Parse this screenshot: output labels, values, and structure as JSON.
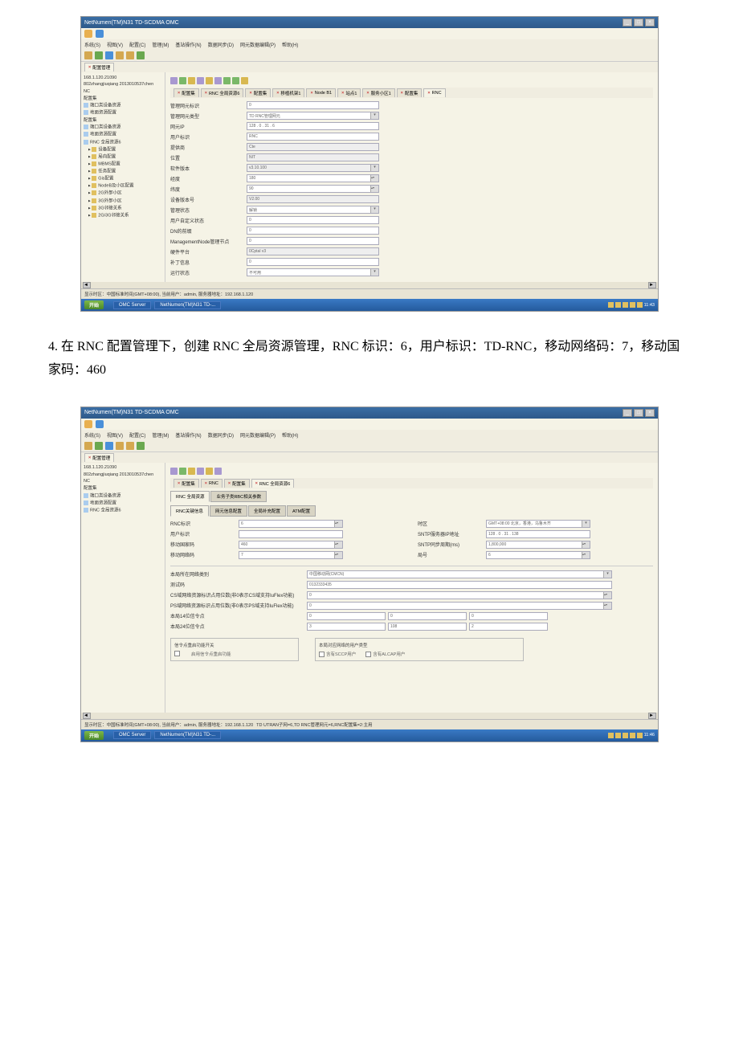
{
  "s1": {
    "title": "NetNumen(TM)N31 TD-SCDMA OMC",
    "menu": [
      "系统(S)",
      "视图(V)",
      "配置(C)",
      "管理(M)",
      "基站操作(N)",
      "数据同步(D)",
      "网元数据编辑(P)",
      "帮助(H)"
    ],
    "toolbar_tab": "配置管理",
    "tree": [
      {
        "t": "168.1.120.21090",
        "l": 0
      },
      {
        "t": "802zhangjiuqiang 2013010537chen",
        "l": 0
      },
      {
        "t": "NC",
        "l": 0
      },
      {
        "t": "配置集",
        "l": 0
      },
      {
        "t": "端口类设备资源",
        "l": 0,
        "ic": "doc"
      },
      {
        "t": "地面资源配置",
        "l": 0,
        "ic": "doc"
      },
      {
        "t": "配置集",
        "l": 0
      },
      {
        "t": "端口类设备资源",
        "l": 0,
        "ic": "doc"
      },
      {
        "t": "地面资源配置",
        "l": 0,
        "ic": "doc"
      },
      {
        "t": "RNC 全局资源6",
        "l": 0,
        "ic": "doc"
      },
      {
        "t": "设备配置",
        "l": 1,
        "ic": "folder"
      },
      {
        "t": "局向配置",
        "l": 1,
        "ic": "folder"
      },
      {
        "t": "MBMS配置",
        "l": 1,
        "ic": "folder"
      },
      {
        "t": "任务配置",
        "l": 1,
        "ic": "folder"
      },
      {
        "t": "Gis配置",
        "l": 1,
        "ic": "folder"
      },
      {
        "t": "NodeB及小区配置",
        "l": 1,
        "ic": "folder"
      },
      {
        "t": "2G外部小区",
        "l": 1,
        "ic": "folder"
      },
      {
        "t": "3G外部小区",
        "l": 1,
        "ic": "folder"
      },
      {
        "t": "3G邻接关系",
        "l": 1,
        "ic": "folder"
      },
      {
        "t": "2G/3G邻接关系",
        "l": 1,
        "ic": "folder"
      }
    ],
    "tabs": [
      "配置集",
      "RNC 全局资源6",
      "配置集",
      "移植机架1",
      "Node B1",
      "站点1",
      "服务小区1",
      "配置集",
      "RNC"
    ],
    "form": [
      {
        "k": "管理网元标识",
        "v": "0"
      },
      {
        "k": "管理网元类型",
        "v": "TD RNC管理网元",
        "dd": true
      },
      {
        "k": "网元IP",
        "v": "128 . 0 . 31 . 6"
      },
      {
        "k": "用户标识",
        "v": "RNC"
      },
      {
        "k": "提供商",
        "v": "Cte",
        "ro": true
      },
      {
        "k": "位置",
        "v": "NIT",
        "ro": true
      },
      {
        "k": "软件版本",
        "v": "v3.10.100",
        "dd": true,
        "ro": true
      },
      {
        "k": "经度",
        "v": "180",
        "sp": true
      },
      {
        "k": "纬度",
        "v": "90",
        "sp": true
      },
      {
        "k": "设备版本号",
        "v": "V2.00",
        "ro": true
      },
      {
        "k": "管理状态",
        "v": "解锁",
        "dd": true
      },
      {
        "k": "用户自定义状态",
        "v": "0"
      },
      {
        "k": "DN的前缀",
        "v": "0"
      },
      {
        "k": "ManagementNode管理节点",
        "v": "0"
      },
      {
        "k": "硬件平台",
        "v": "0Cptal v3",
        "ro": true
      },
      {
        "k": "补丁信息",
        "v": "0"
      },
      {
        "k": "运行状态",
        "v": "不可用",
        "dd": true
      }
    ],
    "status": "显示时区：中国标准时间(GMT+08:00), 当前用户：admin, 服务器地址：192.168.1.120",
    "taskbar": {
      "start": "开始",
      "items": [
        "OMC Server",
        "NetNumen(TM)N31 TD-..."
      ],
      "time": "11:43"
    }
  },
  "caption": "4. 在 RNC 配置管理下，创建 RNC 全局资源管理，RNC 标识：6，用户标识：TD-RNC，移动网络码：7，移动国家码：460",
  "s2": {
    "title": "NetNumen(TM)N31 TD-SCDMA OMC",
    "menu": [
      "系统(S)",
      "视图(V)",
      "配置(C)",
      "管理(M)",
      "基站操作(N)",
      "数据同步(D)",
      "网元数据编辑(P)",
      "帮助(H)"
    ],
    "toolbar_tab": "配置管理",
    "tree": [
      {
        "t": "168.1.120.21090",
        "l": 0
      },
      {
        "t": "802zhangjiuqiang 2013010537chen",
        "l": 0
      },
      {
        "t": "NC",
        "l": 0
      },
      {
        "t": "配置集",
        "l": 0
      },
      {
        "t": "端口类设备资源",
        "l": 0,
        "ic": "doc"
      },
      {
        "t": "地面资源配置",
        "l": 0,
        "ic": "doc"
      },
      {
        "t": "RNC 全局资源6",
        "l": 0,
        "ic": "doc"
      }
    ],
    "tabs": [
      "配置集",
      "RNC",
      "配置集",
      "RNC 全局资源6"
    ],
    "subtabs_top": [
      "RNC 全局资源",
      "业务子类RBC相关参数"
    ],
    "subtabs_bot": [
      "RNC关键信息",
      "网元信息配置",
      "全局补充配置",
      "ATM配置"
    ],
    "left_fields": [
      {
        "k": "RNC标识",
        "v": "6",
        "sp": true
      },
      {
        "k": "用户标识",
        "v": ""
      },
      {
        "k": "移动国家码",
        "v": "460",
        "sp": true
      },
      {
        "k": "移动网络码",
        "v": "7",
        "sp": true
      }
    ],
    "right_fields": [
      {
        "k": "时区",
        "v": "GMT+08:00 北京，香港，乌鲁木齐",
        "dd": true
      },
      {
        "k": "SNTP服务器IP地址",
        "v": "128 . 0 . 31 . 138"
      },
      {
        "k": "SNTP同步周期(ms)",
        "v": "1,800,000",
        "sp": true
      },
      {
        "k": "局号",
        "v": "6",
        "sp": true
      }
    ],
    "wide_fields": [
      {
        "k": "本局所在网络类别",
        "v": "中国移动网(CMCN)",
        "dd": true
      },
      {
        "k": "测试码",
        "v": "0132333435"
      },
      {
        "k": "CS域网络资源标识占用位数(非0表示CS域支持IuFlex功能)",
        "v": "0",
        "sp": true
      },
      {
        "k": "PS域网络资源标识占用位数(非0表示PS域支持IuFlex功能)",
        "v": "0",
        "sp": true
      }
    ],
    "sp14_label": "本局14位信令点",
    "sp14": [
      "0",
      "0",
      "0"
    ],
    "sp24_label": "本局24位信令点",
    "sp24": [
      "3",
      "108",
      "2"
    ],
    "group1": {
      "title": "信令点重启功能开关",
      "opt": "启用信令点重启功能"
    },
    "group2": {
      "title": "本局对应网络的用户类型",
      "opts": [
        "含有SCCP用户",
        "含有ALCAP用户"
      ]
    },
    "status": "显示时区：中国标准时间(GMT+08:00), 当前用户：admin, 服务器地址：192.168.1.120",
    "status2": "TD UTRAN子网=6,TD RNC管理网元=6,RNC配置集=2:主用",
    "taskbar": {
      "start": "开始",
      "items": [
        "OMC Server",
        "NetNumen(TM)N31 TD-..."
      ],
      "time": "11:46"
    }
  }
}
